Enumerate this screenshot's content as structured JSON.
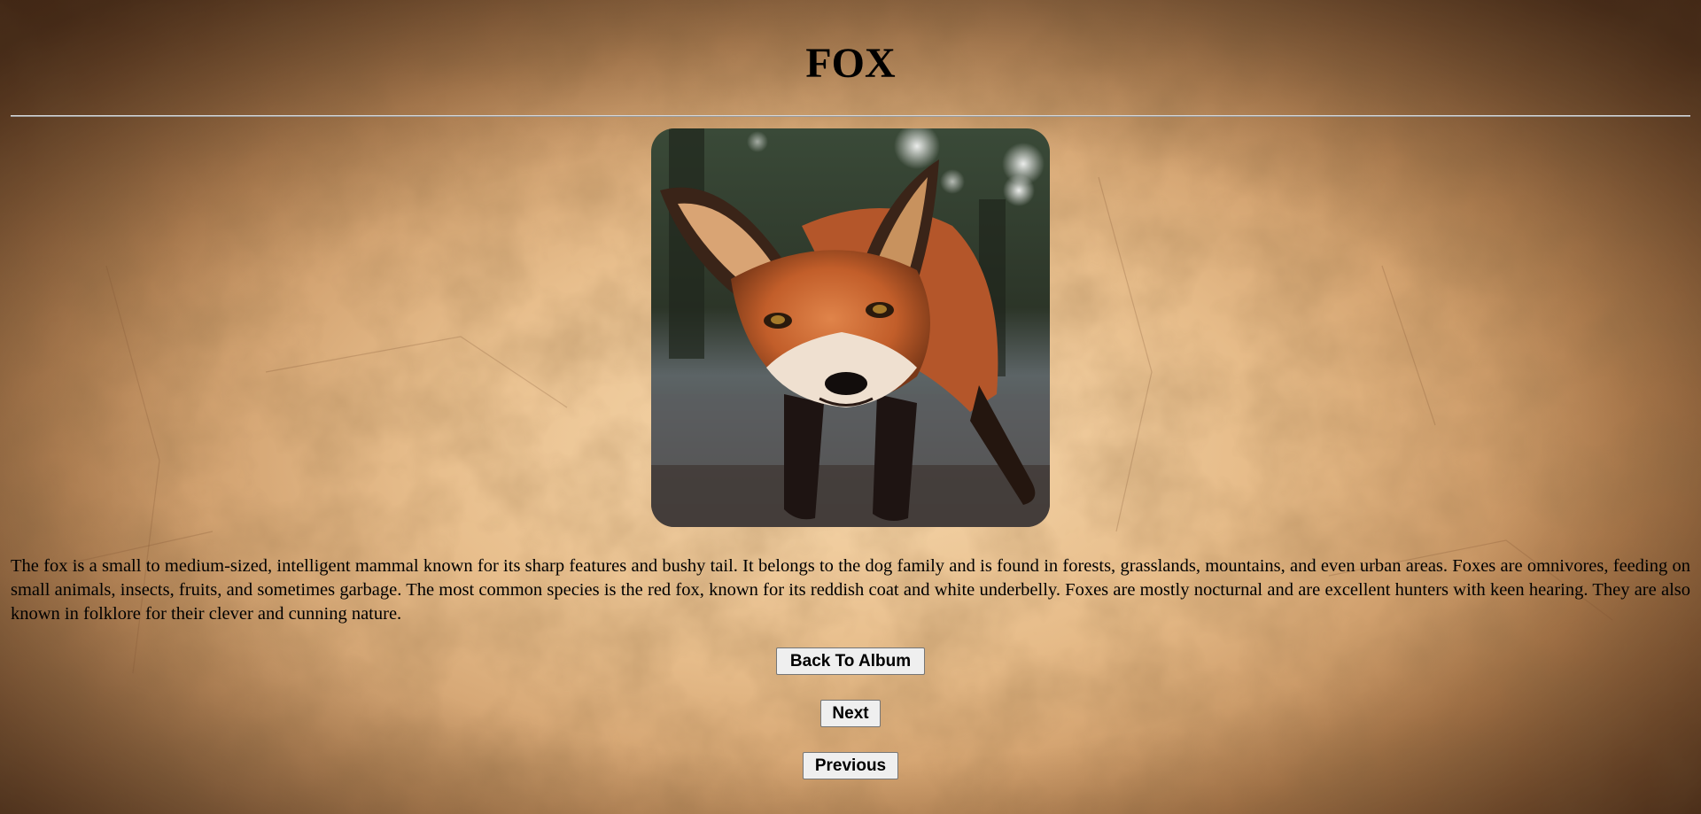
{
  "page": {
    "title": "FOX",
    "description": "The fox is a small to medium-sized, intelligent mammal known for its sharp features and bushy tail. It belongs to the dog family and is found in forests, grasslands, mountains, and even urban areas. Foxes are omnivores, feeding on small animals, insects, fruits, and sometimes garbage. The most common species is the red fox, known for its reddish coat and white underbelly. Foxes are mostly nocturnal and are excellent hunters with keen hearing. They are also known in folklore for their clever and cunning nature."
  },
  "buttons": {
    "back_label": "Back To Album",
    "next_label": "Next",
    "previous_label": "Previous"
  },
  "colors": {
    "background_light": "#f2d3a8",
    "background_dark": "#5a3a22",
    "fox_fur": "#c8612a",
    "button_bg": "#efefef"
  }
}
